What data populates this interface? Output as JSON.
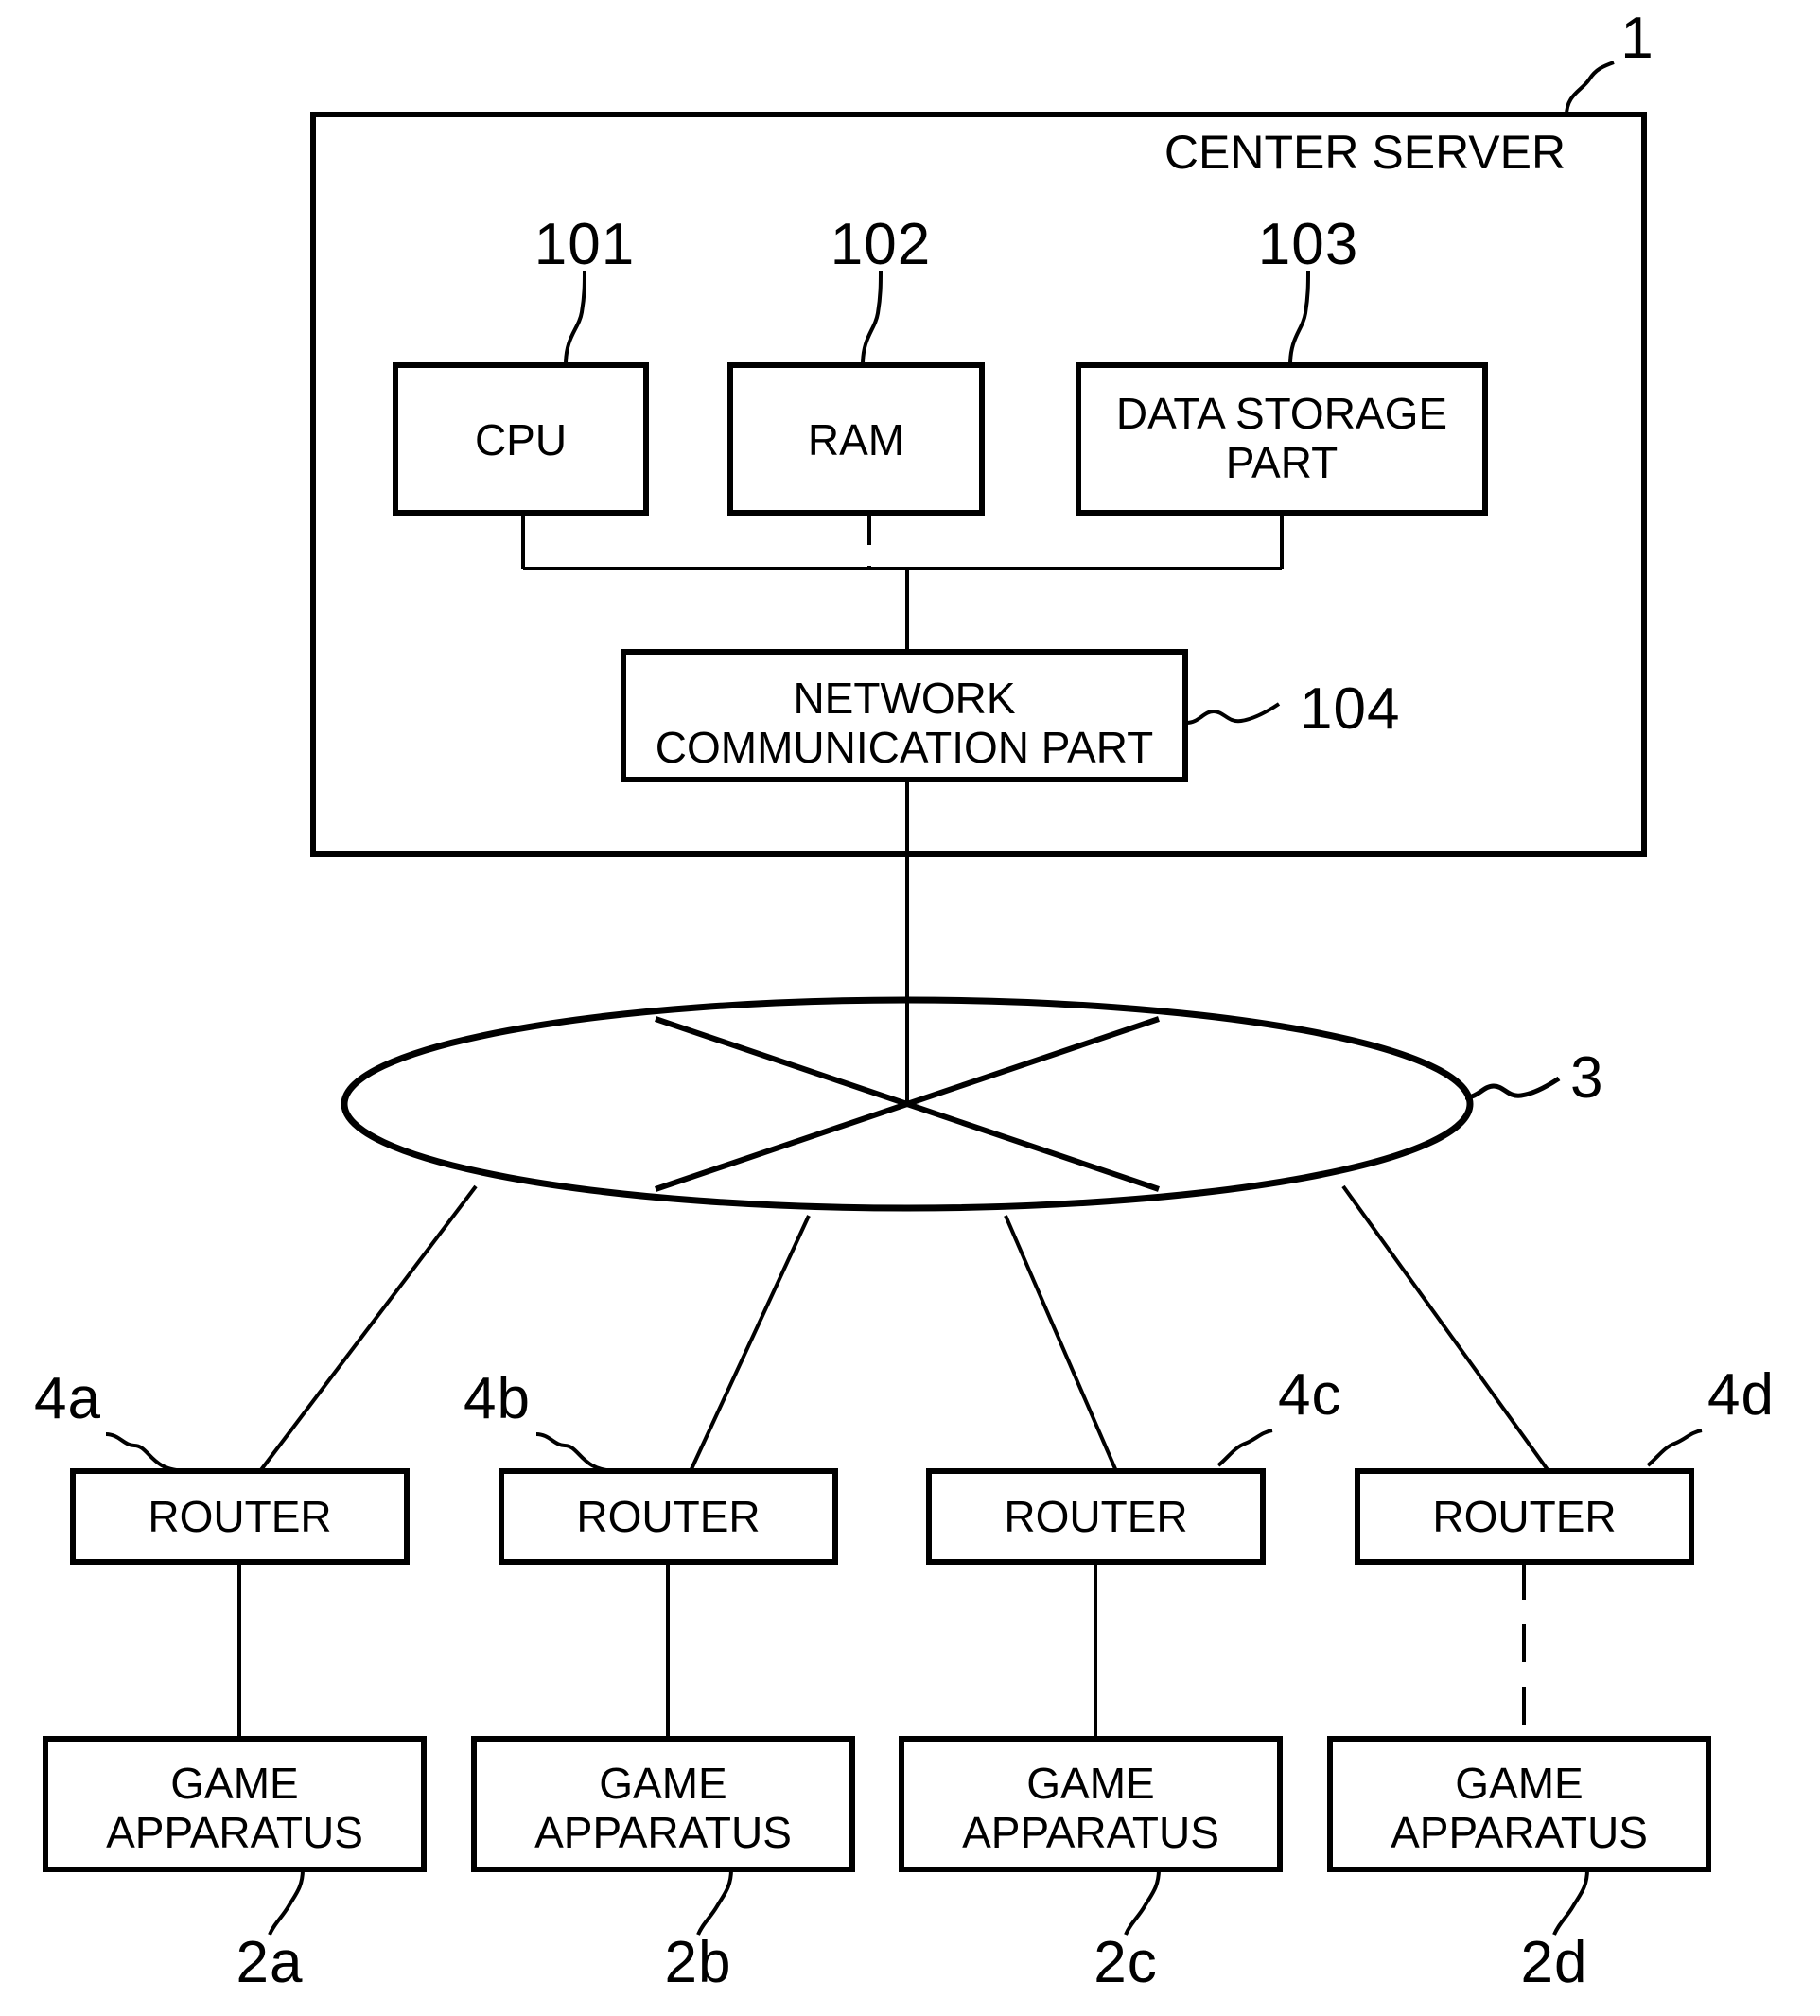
{
  "figure": {
    "type": "network-block-diagram",
    "background_color": "#ffffff",
    "line_color": "#000000"
  },
  "server": {
    "title": "CENTER SERVER",
    "ref": "1",
    "components": [
      {
        "label": "CPU",
        "ref": "101"
      },
      {
        "label": "RAM",
        "ref": "102"
      },
      {
        "label": "DATA STORAGE\nPART",
        "ref": "103"
      },
      {
        "label": "NETWORK\nCOMMUNICATION PART",
        "ref": "104"
      }
    ]
  },
  "network": {
    "ref": "3",
    "shape": "cloud-ellipse"
  },
  "branches": [
    {
      "router": {
        "label": "ROUTER",
        "ref": "4a"
      },
      "game": {
        "label": "GAME\nAPPARATUS",
        "ref": "2a"
      },
      "link_style": "solid"
    },
    {
      "router": {
        "label": "ROUTER",
        "ref": "4b"
      },
      "game": {
        "label": "GAME\nAPPARATUS",
        "ref": "2b"
      },
      "link_style": "solid"
    },
    {
      "router": {
        "label": "ROUTER",
        "ref": "4c"
      },
      "game": {
        "label": "GAME\nAPPARATUS",
        "ref": "2c"
      },
      "link_style": "solid"
    },
    {
      "router": {
        "label": "ROUTER",
        "ref": "4d"
      },
      "game": {
        "label": "GAME\nAPPARATUS",
        "ref": "2d"
      },
      "link_style": "dashed"
    }
  ]
}
